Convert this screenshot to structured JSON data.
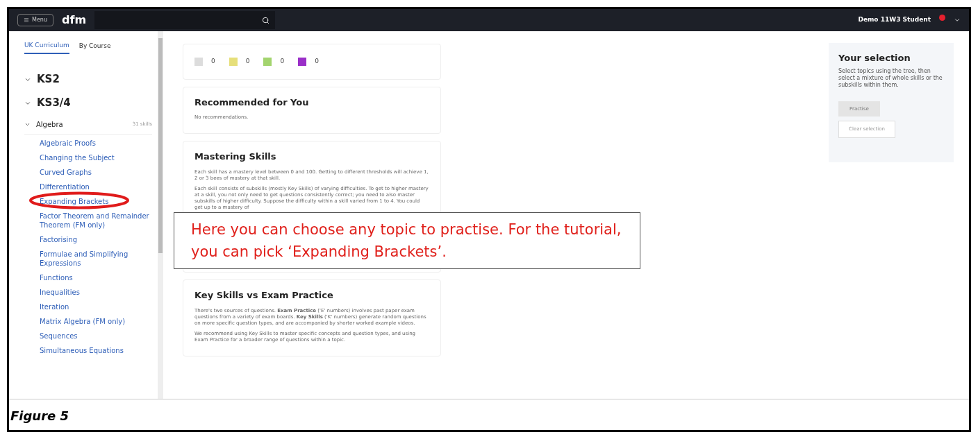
{
  "top_bar": {
    "menu_button": "Menu",
    "logo": "dfm",
    "user": "Demo 11W3 Student",
    "notification": true
  },
  "sidebar": {
    "tabs": [
      {
        "label": "UK Curriculum",
        "selected": true
      },
      {
        "label": "By Course",
        "selected": false
      }
    ],
    "tree": [
      {
        "label": "KS2"
      },
      {
        "label": "KS3/4",
        "children": [
          {
            "label": "Algebra",
            "count": "31 skills",
            "children": [
              {
                "label": "Algebraic Proofs",
                "highlighted": false
              },
              {
                "label": "Changing the Subject",
                "highlighted": false
              },
              {
                "label": "Curved Graphs",
                "highlighted": false
              },
              {
                "label": "Differentiation",
                "highlighted": false
              },
              {
                "label": "Expanding Brackets",
                "highlighted": true
              },
              {
                "label": "Factor Theorem and Remainder Theorem (FM only)",
                "highlighted": false
              },
              {
                "label": "Factorising",
                "highlighted": false
              },
              {
                "label": "Formulae and Simplifying Expressions",
                "highlighted": false
              },
              {
                "label": "Functions",
                "highlighted": false
              },
              {
                "label": "Inequalities",
                "highlighted": false
              },
              {
                "label": "Iteration",
                "highlighted": false
              },
              {
                "label": "Matrix Algebra (FM only)",
                "highlighted": false
              },
              {
                "label": "Sequences",
                "highlighted": false
              },
              {
                "label": "Simultaneous Equations",
                "highlighted": false
              }
            ]
          }
        ]
      }
    ]
  },
  "legend": [
    {
      "color": "#dcdcdc",
      "count": "0"
    },
    {
      "color": "#e6df7a",
      "count": "0"
    },
    {
      "color": "#a3d46e",
      "count": "0"
    },
    {
      "color": "#9a2fc8",
      "count": "0"
    }
  ],
  "cards": [
    {
      "title": "Recommended for You",
      "paragraphs": [
        "No recommendations."
      ]
    },
    {
      "title": "Mastering Skills",
      "paragraphs": [
        "Each skill has a mastery level between 0 and 100. Getting to different thresholds will achieve 1, 2 or 3 bees of mastery at that skill.",
        "Each skill consists of subskills (mostly Key Skills) of varying difficulties. To get to higher mastery at a skill, you not only need to get questions consistently correct; you need to also master subskills of higher difficulty. Suppose the difficulty within a skill varied from 1 to 4. You could get up to a mastery of"
      ]
    },
    {
      "title": "Key Skills vs Exam Practice",
      "paragraphs": [
        "There's two sources of questions. **Exam Practice** ('E' numbers) involves past paper exam questions from a variety of exam boards. **Key Skills** ('K' numbers) generate random questions on more specific question types, and are accompanied by shorter worked example videos.",
        "We recommend using Key Skills to master specific concepts and question types, and using Exam Practice for a broader range of questions within a topic."
      ]
    }
  ],
  "selection": {
    "title": "Your selection",
    "text": "Select topics using the tree, then select a mixture of whole skills or the subskills within them.",
    "buttons": [
      "Practise",
      "Clear selection"
    ]
  },
  "callout": "Here you can choose any topic to practise. For the tutorial, you can pick ‘Expanding Brackets’.",
  "caption": "Figure 5"
}
